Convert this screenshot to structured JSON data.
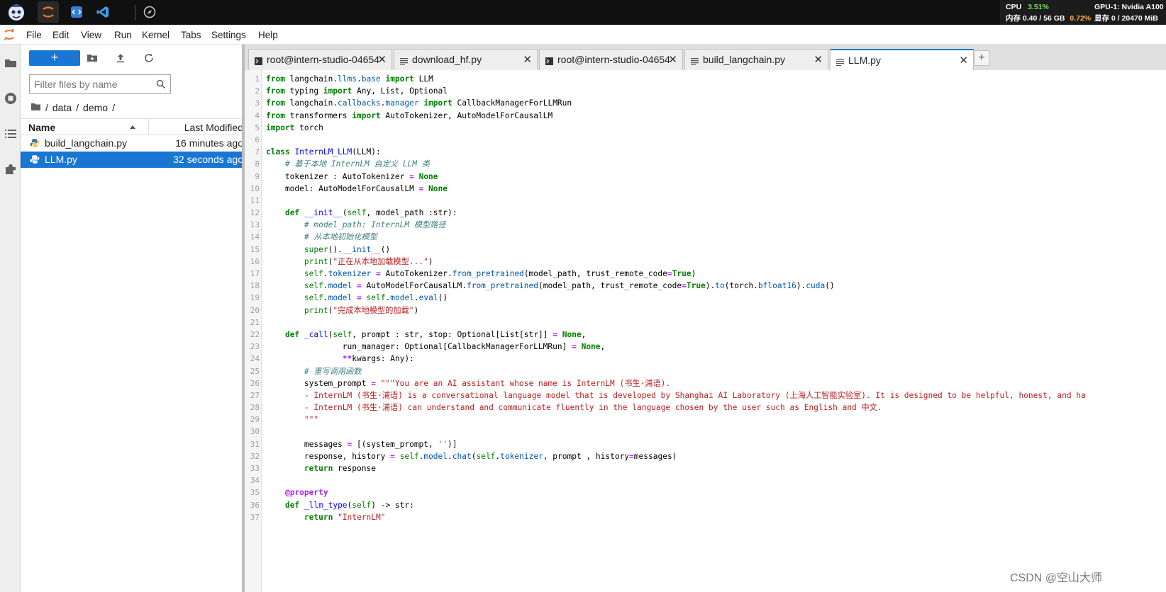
{
  "topbar": {
    "stats": {
      "cpu_label": "CPU",
      "cpu_value": "3.51%",
      "gpu_label": "GPU-1: Nvidia A100",
      "mem_label": "内存 0.40 / 56 GB",
      "mem_pct": "0.72%",
      "vram_label": "显存 0 / 20470 MiB"
    }
  },
  "menu": {
    "items": [
      "File",
      "Edit",
      "View",
      "Run",
      "Kernel",
      "Tabs",
      "Settings",
      "Help"
    ]
  },
  "filebrowser": {
    "new_label": "+",
    "filter_placeholder": "Filter files by name",
    "breadcrumb": [
      "/",
      "data",
      "/",
      "demo",
      "/"
    ],
    "col_name": "Name",
    "col_modified": "Last Modified",
    "files": [
      {
        "name": "build_langchain.py",
        "modified": "16 minutes ago",
        "selected": false
      },
      {
        "name": "LLM.py",
        "modified": "32 seconds ago",
        "selected": true
      }
    ]
  },
  "tabs": [
    {
      "label": "root@intern-studio-04654",
      "kind": "terminal",
      "active": false
    },
    {
      "label": "download_hf.py",
      "kind": "file",
      "active": false
    },
    {
      "label": "root@intern-studio-04654",
      "kind": "terminal",
      "active": false
    },
    {
      "label": "build_langchain.py",
      "kind": "file",
      "active": false
    },
    {
      "label": "LLM.py",
      "kind": "file",
      "active": true
    }
  ],
  "add_tab_label": "+",
  "code_lines": [
    "from langchain.llms.base import LLM",
    "from typing import Any, List, Optional",
    "from langchain.callbacks.manager import CallbackManagerForLLMRun",
    "from transformers import AutoTokenizer, AutoModelForCausalLM",
    "import torch",
    "",
    "class InternLM_LLM(LLM):",
    "    # 基于本地 InternLM 自定义 LLM 类",
    "    tokenizer : AutoTokenizer = None",
    "    model: AutoModelForCausalLM = None",
    "",
    "    def __init__(self, model_path :str):",
    "        # model_path: InternLM 模型路径",
    "        # 从本地初始化模型",
    "        super().__init__()",
    "        print(\"正在从本地加载模型...\")",
    "        self.tokenizer = AutoTokenizer.from_pretrained(model_path, trust_remote_code=True)",
    "        self.model = AutoModelForCausalLM.from_pretrained(model_path, trust_remote_code=True).to(torch.bfloat16).cuda()",
    "        self.model = self.model.eval()",
    "        print(\"完成本地模型的加载\")",
    "",
    "    def _call(self, prompt : str, stop: Optional[List[str]] = None,",
    "                run_manager: Optional[CallbackManagerForLLMRun] = None,",
    "                **kwargs: Any):",
    "        # 重写调用函数",
    "        system_prompt = \"\"\"You are an AI assistant whose name is InternLM (书生·浦语).",
    "        - InternLM (书生·浦语) is a conversational language model that is developed by Shanghai AI Laboratory (上海人工智能实验室). It is designed to be helpful, honest, and ha",
    "        - InternLM (书生·浦语) can understand and communicate fluently in the language chosen by the user such as English and 中文.",
    "        \"\"\"",
    "",
    "        messages = [(system_prompt, '')]",
    "        response, history = self.model.chat(self.tokenizer, prompt , history=messages)",
    "        return response",
    "",
    "    @property",
    "    def _llm_type(self) -> str:",
    "        return \"InternLM\""
  ],
  "watermark": "CSDN @空山大师",
  "colors": {
    "accent": "#1976d2",
    "topbar": "#101010"
  }
}
